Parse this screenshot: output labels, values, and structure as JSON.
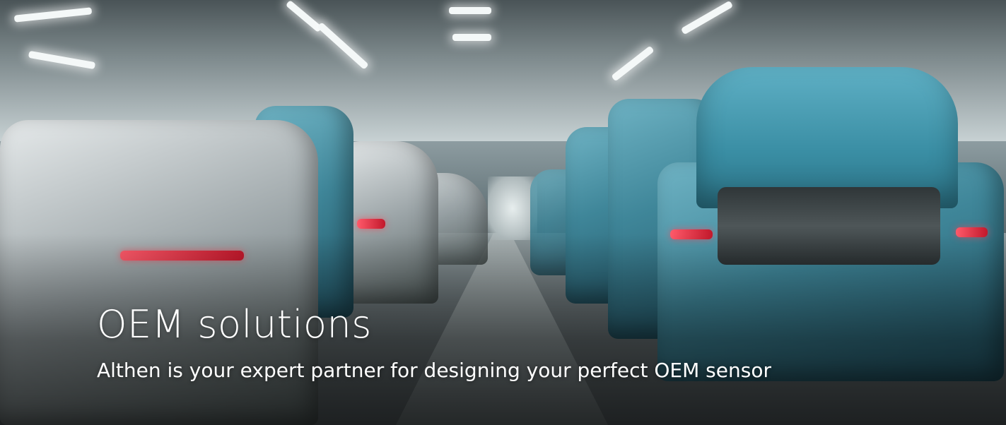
{
  "hero": {
    "title": "OEM solutions",
    "subtitle": "Althen is your expert partner for designing your perfect OEM sensor"
  }
}
